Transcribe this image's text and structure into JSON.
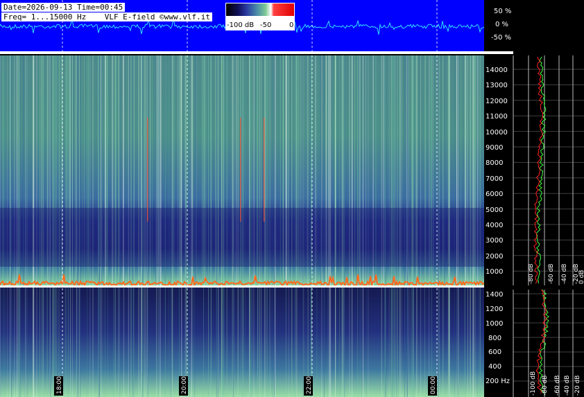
{
  "header": {
    "date_time": "Date=2026-09-13 Time=00:45",
    "freq_line": "Freq= 1...15000 Hz    VLF E-field ©www.vlf.it"
  },
  "colorbar": {
    "label_low": "-100 dB",
    "label_mid": "-50",
    "label_high": "0"
  },
  "waveform": {
    "scale_labels": [
      "50 %",
      "0 %",
      "-50 %"
    ]
  },
  "main_spectrogram": {
    "freq_labels": [
      "14000",
      "13000",
      "12000",
      "11000",
      "10000",
      "9000",
      "8000",
      "7000",
      "6000",
      "5000",
      "4000",
      "3000",
      "2000",
      "1000"
    ],
    "db_labels": [
      "0 dB",
      "-20 dB",
      "-40 dB",
      "-60 dB",
      "-80 dB"
    ]
  },
  "zoom_spectrogram": {
    "freq_labels": [
      "1400",
      "1200",
      "1000",
      "800",
      "600",
      "400",
      "200 Hz"
    ],
    "db_labels": [
      "-100 dB",
      "-80 dB",
      "-60 dB",
      "-40 dB",
      "-20 dB"
    ]
  },
  "time_labels": [
    "18:00",
    "20:00",
    "22:00",
    "00:00"
  ],
  "colors": {
    "waveform_bg": "#0000ff",
    "waveform_trace": "#33e0ff",
    "grid": "#ffffff",
    "red_curve": "#ff2020",
    "green_curve": "#40ff40"
  }
}
